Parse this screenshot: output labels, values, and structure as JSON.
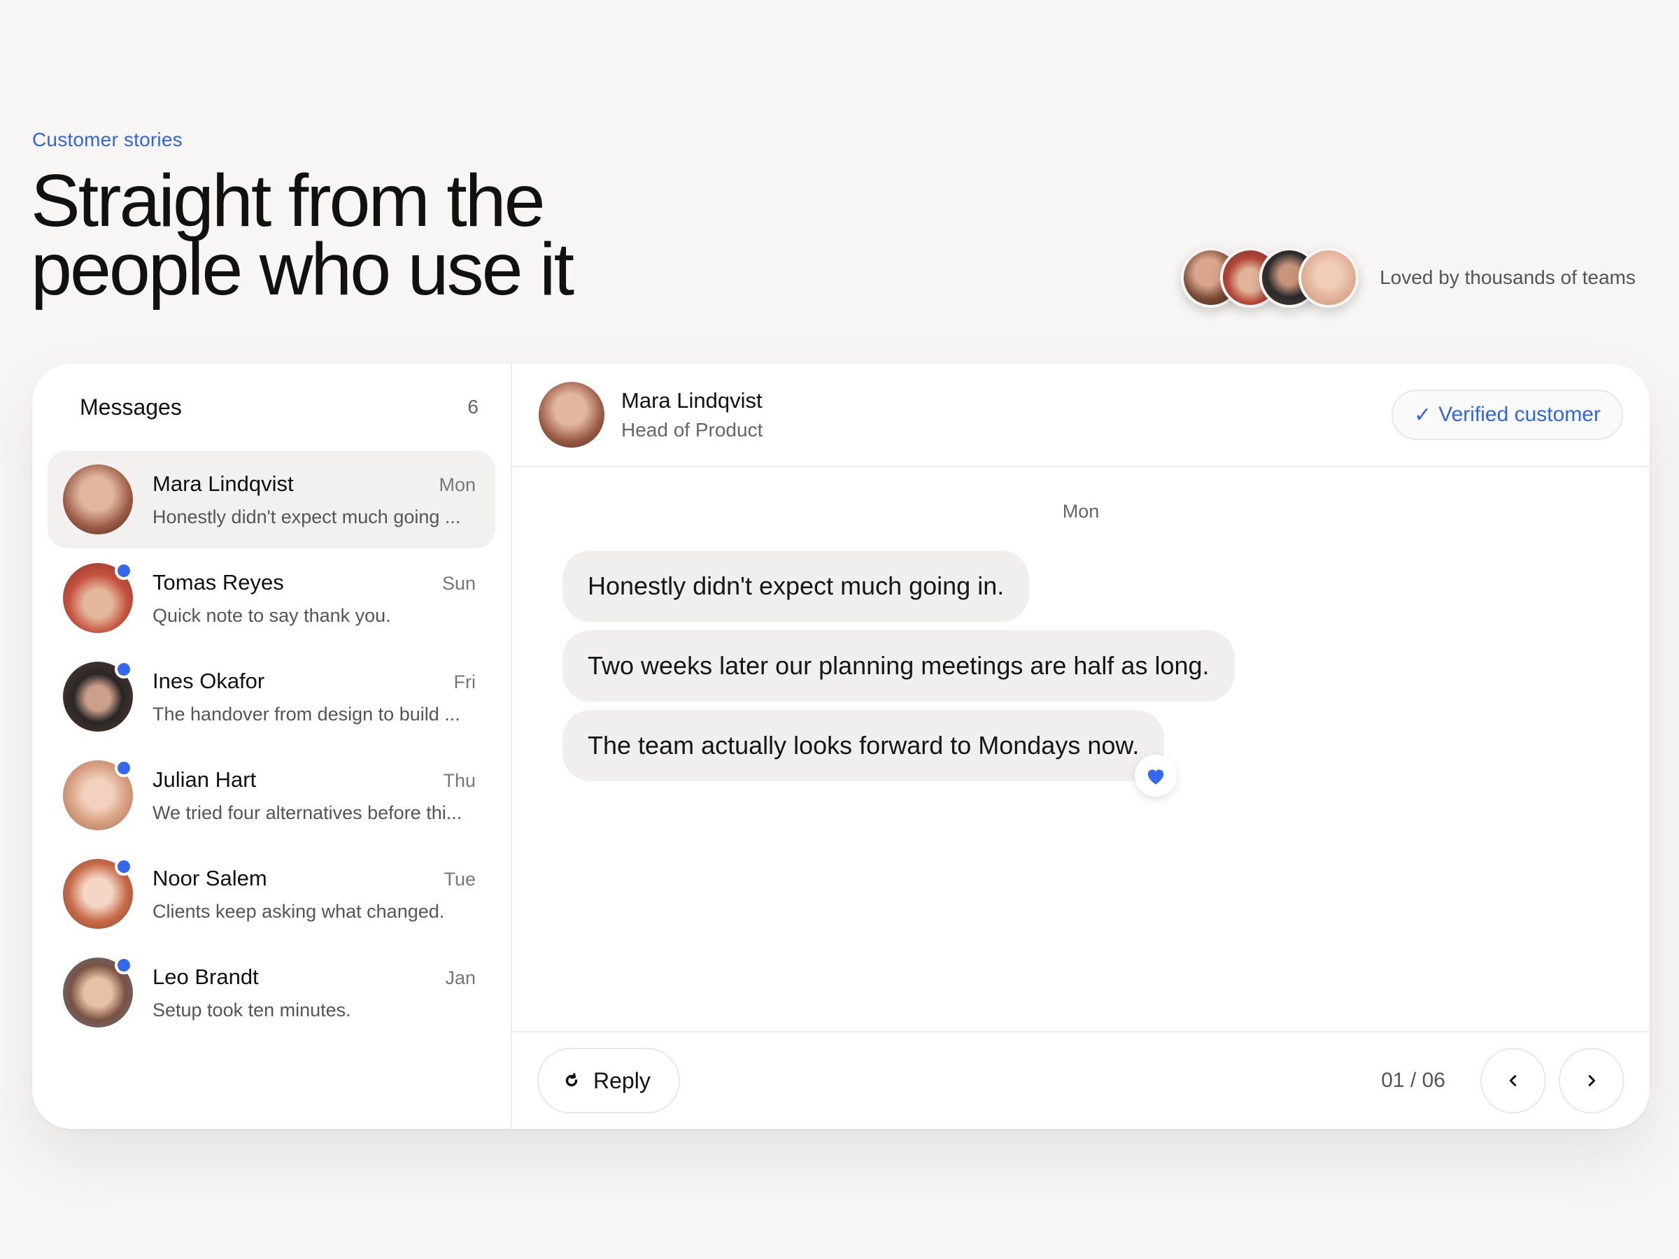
{
  "hero": {
    "eyebrow": "Customer stories",
    "title_line1": "Straight from the",
    "title_line2": "people who use it",
    "social_proof": "Loved by thousands of teams"
  },
  "sidebar": {
    "title": "Messages",
    "count": "6",
    "threads": [
      {
        "name": "Mara Lindqvist",
        "day": "Mon",
        "preview": "Honestly didn't expect much going ...",
        "unread": false,
        "active": true
      },
      {
        "name": "Tomas Reyes",
        "day": "Sun",
        "preview": "Quick note to say thank you.",
        "unread": true,
        "active": false
      },
      {
        "name": "Ines Okafor",
        "day": "Fri",
        "preview": "The handover from design to build ...",
        "unread": true,
        "active": false
      },
      {
        "name": "Julian Hart",
        "day": "Thu",
        "preview": "We tried four alternatives before thi...",
        "unread": true,
        "active": false
      },
      {
        "name": "Noor Salem",
        "day": "Tue",
        "preview": "Clients keep asking what changed.",
        "unread": true,
        "active": false
      },
      {
        "name": "Leo Brandt",
        "day": "Jan",
        "preview": "Setup took ten minutes.",
        "unread": true,
        "active": false
      }
    ]
  },
  "conversation": {
    "contact_name": "Mara Lindqvist",
    "contact_role": "Head of Product",
    "badge_label": "Verified customer",
    "day_label": "Mon",
    "messages": [
      "Honestly didn't expect much going in.",
      "Two weeks later our planning meetings are half as long.",
      "The team actually looks forward to Mondays now."
    ],
    "reaction_icon": "heart-icon",
    "reply_label": "Reply",
    "pager": "01 / 06"
  },
  "colors": {
    "accent": "#2f66e8",
    "unread_dot": "#3568f0",
    "background": "#f7f6f4"
  }
}
